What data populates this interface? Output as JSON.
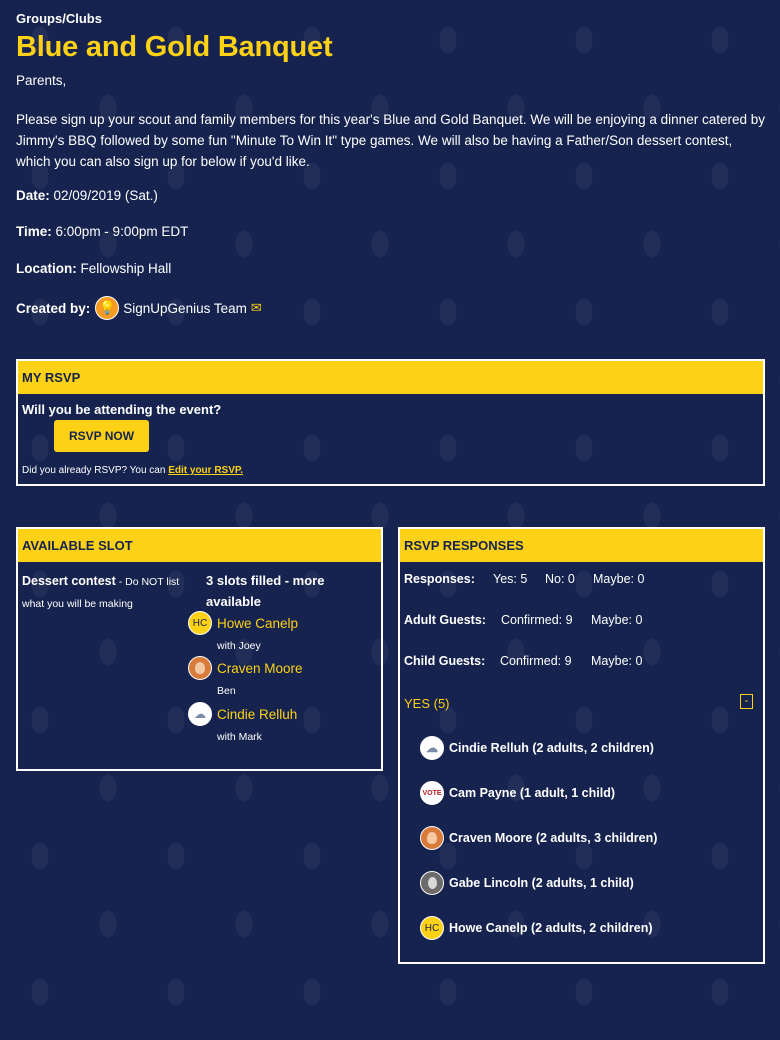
{
  "header": {
    "category": "Groups/Clubs",
    "title": "Blue and Gold Banquet",
    "greeting": "Parents,",
    "description": "Please sign up your scout and family members for this year's Blue and Gold Banquet. We will be enjoying a dinner catered by Jimmy's BBQ followed by some fun \"Minute To Win It\" type games. We will also be having a Father/Son dessert contest, which you can also sign up for below if you'd like."
  },
  "details": {
    "date_label": "Date:",
    "date_value": "02/09/2019 (Sat.)",
    "time_label": "Time:",
    "time_value": "6:00pm - 9:00pm EDT",
    "location_label": "Location:",
    "location_value": "Fellowship Hall",
    "created_label": "Created by:",
    "created_value": "SignUpGenius Team",
    "creator_icon": "lightbulb-icon",
    "mail_icon": "envelope-icon"
  },
  "my_rsvp": {
    "heading": "MY RSVP",
    "question": "Will you be attending the event?",
    "button": "RSVP NOW",
    "note": "Did you already RSVP? You can ",
    "edit_link": "Edit your RSVP."
  },
  "slots": {
    "heading": "AVAILABLE SLOT",
    "slot_name": "Dessert contest",
    "slot_note": " - Do NOT list what you will be making",
    "filled": "3 slots filled - more available",
    "signups": [
      {
        "initials": "HC",
        "name": "Howe Canelp",
        "sub": "with Joey"
      },
      {
        "initials": "",
        "name": "Craven Moore",
        "sub": "Ben"
      },
      {
        "initials": "",
        "name": "Cindie Relluh",
        "sub": "with Mark"
      }
    ]
  },
  "responses": {
    "heading": "RSVP RESPONSES",
    "rows": [
      {
        "label": "Responses:",
        "a": "Yes: 5",
        "b": "No: 0",
        "c": "Maybe: 0"
      },
      {
        "label": "Adult Guests:",
        "a": "Confirmed: 9",
        "b": "Maybe: 0"
      },
      {
        "label": "Child Guests:",
        "a": "Confirmed: 9",
        "b": "Maybe: 0"
      }
    ],
    "yes_label": "YES (5)",
    "collapse": "-",
    "people": [
      {
        "text": "Cindie Relluh (2 adults, 2 children)",
        "avatar": "cloud-icon"
      },
      {
        "text": "Cam Payne (1 adult, 1 child)",
        "avatar": "vote-icon",
        "badge": "VOTE"
      },
      {
        "text": "Craven Moore (2 adults, 3 children)",
        "avatar": "person-icon"
      },
      {
        "text": "Gabe Lincoln (2 adults, 1 child)",
        "avatar": "portrait-icon"
      },
      {
        "text": "Howe Canelp (2 adults, 2 children)",
        "avatar": "initials",
        "initials": "HC"
      }
    ]
  },
  "colors": {
    "background": "#16234f",
    "accent": "#fcd116",
    "text": "#ffffff"
  }
}
